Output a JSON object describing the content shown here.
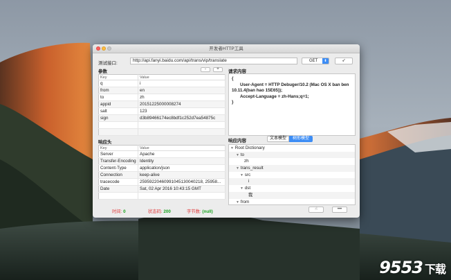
{
  "window": {
    "title": "开发者HTTP工具"
  },
  "request": {
    "url_label": "测试接口:",
    "url": "http://api.fanyi.baidu.com/api/trans/vip/translate",
    "method": "GET",
    "method_arrow": "⬍",
    "send_icon": "paper-plane-icon",
    "send_glyph": "➶"
  },
  "params": {
    "title": "参数",
    "remove_label": "-",
    "add_label": "+",
    "columns": [
      "Key",
      "Value"
    ],
    "rows": [
      [
        "q",
        "i"
      ],
      [
        "from",
        "en"
      ],
      [
        "to",
        "zh"
      ],
      [
        "appid",
        "20151225000008274"
      ],
      [
        "salt",
        "123"
      ],
      [
        "sign",
        "d3b89466174ec8bdf1c252d7ea54875c"
      ]
    ]
  },
  "request_content": {
    "title": "请求内容",
    "lines": [
      "{",
      "User-Agent = HTTP Debuger/10.2 (Mac OS X ban ben",
      "10.11.4(ban hao 15E65));",
      "Accept-Language = zh-Hans;q=1;",
      "}"
    ]
  },
  "response_headers": {
    "title": "响应头",
    "columns": [
      "Key",
      "Value"
    ],
    "rows": [
      [
        "Server",
        "Apache"
      ],
      [
        "Transfer-Encoding",
        "Identity"
      ],
      [
        "Content-Type",
        "application/json"
      ],
      [
        "Connection",
        "keep-alive"
      ],
      [
        "tracecode",
        "25959220460991045130040218, 25958..."
      ],
      [
        "Date",
        "Sat, 02 Apr 2016 10:43:15 GMT"
      ]
    ]
  },
  "response_content": {
    "title": "响应内容",
    "text_mode": "文本模型",
    "tree_mode": "树形模型",
    "tree": [
      {
        "label": "Root Dictionary",
        "level": 0,
        "expanded": true
      },
      {
        "label": "to",
        "level": 1,
        "expanded": true
      },
      {
        "label": "zh",
        "level": 2,
        "leaf": true
      },
      {
        "label": "trans_result",
        "level": 1,
        "expanded": true
      },
      {
        "label": "src",
        "level": 2,
        "expanded": true
      },
      {
        "label": "i",
        "level": 3,
        "leaf": true
      },
      {
        "label": "dst",
        "level": 2,
        "expanded": true
      },
      {
        "label": "我",
        "level": 3,
        "leaf": true
      },
      {
        "label": "from",
        "level": 1,
        "expanded": true
      }
    ]
  },
  "status": {
    "time_label": "时间:",
    "time_value": "0",
    "code_label": "状态码:",
    "code_value": "200",
    "bytes_label": "字节数:",
    "bytes_value": "(null)"
  },
  "footer": {
    "history_icon": "hand-icon",
    "history_glyph": "☝",
    "more_label": "•••"
  },
  "watermark": {
    "main": "9553",
    "sub": "下载"
  },
  "colors": {
    "accent": "#3d8df5",
    "status_key": "#e03c3c",
    "status_value": "#18a21d"
  }
}
